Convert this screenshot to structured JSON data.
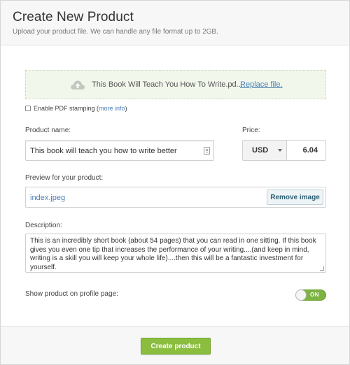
{
  "header": {
    "title": "Create New Product",
    "subtitle": "Upload your product file. We can handle any file format up to 2GB."
  },
  "upload": {
    "icon": "cloud-upload-icon",
    "filename": "This Book Will Teach You How To Write.pd...",
    "replace_label": "Replace file."
  },
  "pdf_stamping": {
    "label": "Enable PDF stamping (",
    "more_info": "more info",
    "suffix": ")",
    "checked": false
  },
  "product_name": {
    "label": "Product name:",
    "value": "This book will teach you how to write better"
  },
  "price": {
    "label": "Price:",
    "currency": "USD",
    "value": "6.04"
  },
  "preview": {
    "label": "Preview for your product:",
    "file": "index.jpeg",
    "remove_label": "Remove image"
  },
  "description": {
    "label": "Description:",
    "value": "This is an incredibly short book (about 54 pages) that you can read in one sitting. If this book gives you even one tip that increases the performance of your writing....(and keep in mind, writing is a skill you will keep your whole life)....then this will be a fantastic investment for yourself."
  },
  "profile_toggle": {
    "label": "Show product on profile page:",
    "state_label": "ON",
    "on": true
  },
  "footer": {
    "create_label": "Create product"
  },
  "colors": {
    "accent_green": "#8bbd3f",
    "toggle_green": "#7cb342",
    "link_blue": "#4a7fb5",
    "dropzone_bg": "#f2f7ec"
  }
}
